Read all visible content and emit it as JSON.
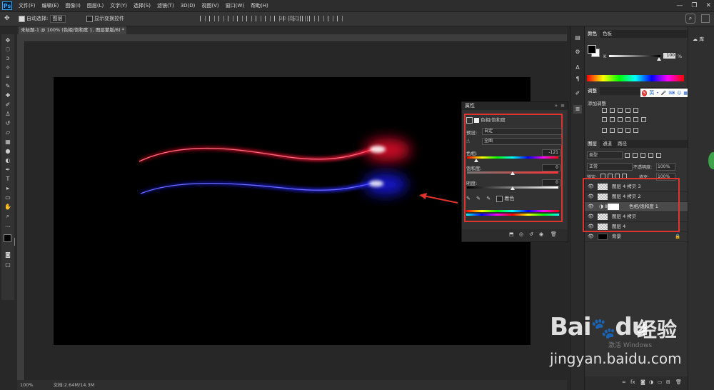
{
  "app": {
    "logo": "Ps"
  },
  "menu": {
    "items": [
      "文件(F)",
      "编辑(E)",
      "图像(I)",
      "图层(L)",
      "文字(Y)",
      "选择(S)",
      "滤镜(T)",
      "3D(D)",
      "视图(V)",
      "窗口(W)",
      "帮助(H)"
    ]
  },
  "window_buttons": {
    "minimize": "—",
    "restore": "❐",
    "close": "✕"
  },
  "options": {
    "auto_select_label": "自动选择:",
    "auto_select_value": "图层",
    "transform_label": "显示变换控件",
    "mode_3d": "3D 模式:"
  },
  "document": {
    "tab_title": "未标题-1 @ 100% (色相/饱和度 1, 图层蒙版/8) *",
    "zoom": "100%",
    "doc_size": "文档:2.64M/14.3M"
  },
  "properties": {
    "panel_title": "属性",
    "adj_title": "色相/饱和度",
    "preset_label": "预设:",
    "preset_value": "自定",
    "channel_value": "全图",
    "hue_label": "色相:",
    "hue_value": "-121",
    "saturation_label": "饱和度:",
    "saturation_value": "0",
    "lightness_label": "明度:",
    "lightness_value": "0",
    "colorize_label": "着色",
    "hue_fraction": 0.1,
    "saturation_fraction": 0.5,
    "lightness_fraction": 0.5
  },
  "color_panel": {
    "tabs": [
      "颜色",
      "色板"
    ],
    "k_label": "K",
    "k_value": "100",
    "percent": "%"
  },
  "adjustments_panel": {
    "title": "调整",
    "add_label": "添加调整"
  },
  "layers_panel": {
    "tabs": [
      "图层",
      "通道",
      "路径"
    ],
    "filter_label": "类型",
    "blend_mode": "正常",
    "opacity_label": "不透明度:",
    "opacity_value": "100%",
    "lock_label": "锁定:",
    "fill_label": "填充:",
    "fill_value": "100%",
    "layers": [
      {
        "name": "图层 4 拷贝 3",
        "type": "pixel"
      },
      {
        "name": "图层 4 拷贝 2",
        "type": "pixel"
      },
      {
        "name": "色相/饱和度 1",
        "type": "adjustment"
      },
      {
        "name": "图层 4 拷贝",
        "type": "pixel"
      },
      {
        "name": "图层 4",
        "type": "pixel"
      },
      {
        "name": "背景",
        "type": "background"
      }
    ]
  },
  "library": {
    "label": "库"
  },
  "ime": {
    "label": "英"
  },
  "watermark": {
    "brand_latin": "Bai",
    "brand_tail": "du",
    "brand_cn": "经验",
    "url": "jingyan.baidu.com",
    "activation": "激活 Windows"
  },
  "colors": {
    "accent_red": "#e0332d",
    "canvas": "#000000"
  }
}
